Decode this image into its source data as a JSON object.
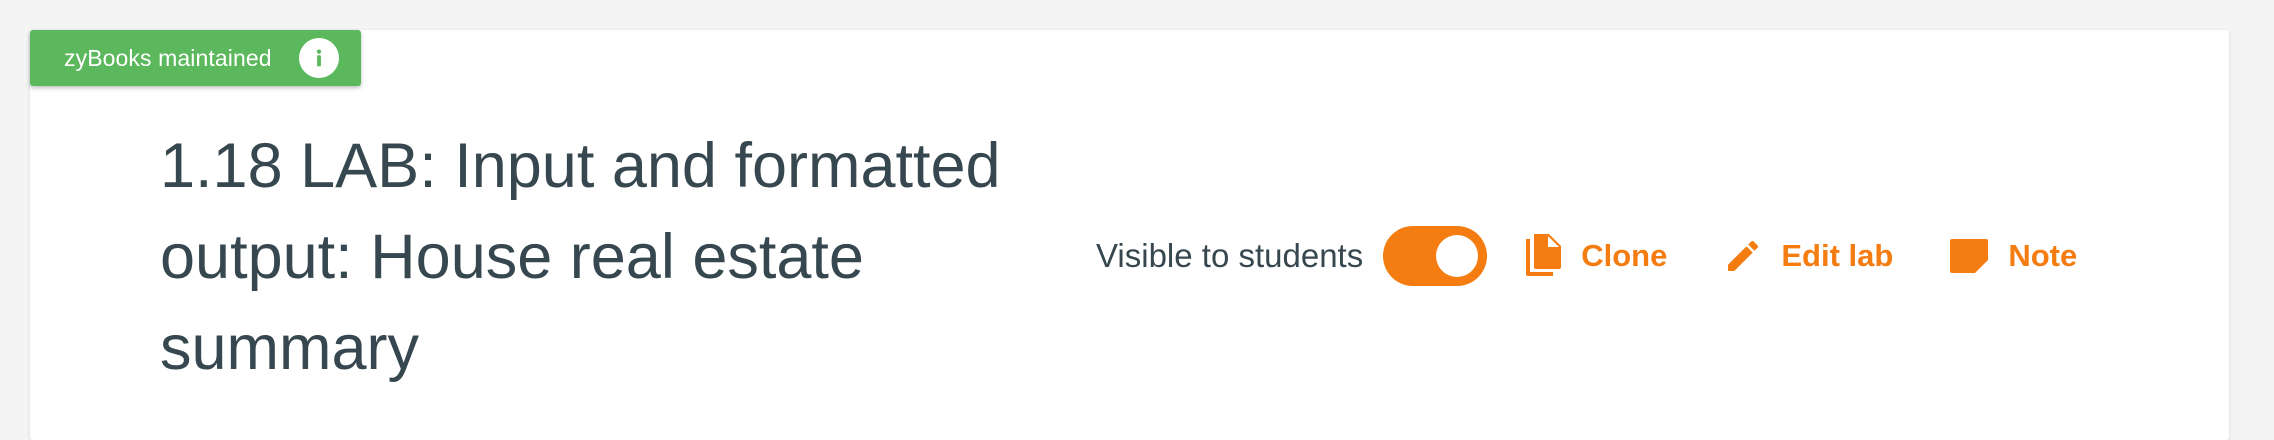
{
  "badge": {
    "label": "zyBooks maintained",
    "info_icon": "info-icon"
  },
  "header": {
    "title": "1.18 LAB: Input and formatted output: House real estate summary"
  },
  "controls": {
    "visible_label": "Visible to students",
    "visible_toggle_on": true,
    "clone_label": "Clone",
    "edit_label": "Edit lab",
    "note_label": "Note"
  },
  "colors": {
    "accent": "#f47c10",
    "badge_green": "#5cb85c",
    "title_text": "#37474f",
    "background": "#f4f4f4"
  }
}
